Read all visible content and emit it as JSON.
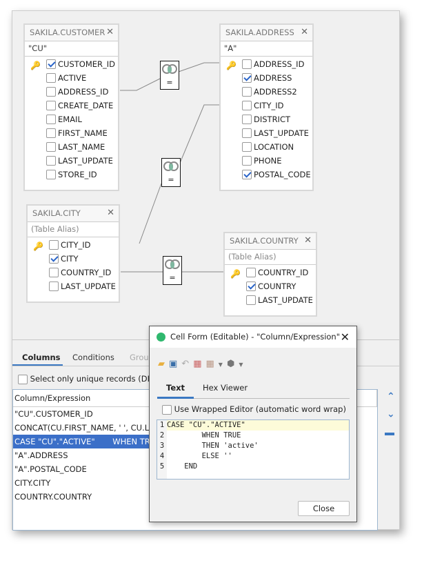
{
  "tables": [
    {
      "name": "SAKILA.CUSTOMER",
      "alias": "\"CU\"",
      "alias_placeholder": false,
      "columns": [
        {
          "label": "CUSTOMER_ID",
          "checked": true,
          "key": true
        },
        {
          "label": "ACTIVE",
          "checked": false
        },
        {
          "label": "ADDRESS_ID",
          "checked": false
        },
        {
          "label": "CREATE_DATE",
          "checked": false
        },
        {
          "label": "EMAIL",
          "checked": false
        },
        {
          "label": "FIRST_NAME",
          "checked": false
        },
        {
          "label": "LAST_NAME",
          "checked": false
        },
        {
          "label": "LAST_UPDATE",
          "checked": false
        },
        {
          "label": "STORE_ID",
          "checked": false
        }
      ]
    },
    {
      "name": "SAKILA.ADDRESS",
      "alias": "\"A\"",
      "alias_placeholder": false,
      "columns": [
        {
          "label": "ADDRESS_ID",
          "checked": false,
          "key": true
        },
        {
          "label": "ADDRESS",
          "checked": true
        },
        {
          "label": "ADDRESS2",
          "checked": false
        },
        {
          "label": "CITY_ID",
          "checked": false
        },
        {
          "label": "DISTRICT",
          "checked": false
        },
        {
          "label": "LAST_UPDATE",
          "checked": false
        },
        {
          "label": "LOCATION",
          "checked": false
        },
        {
          "label": "PHONE",
          "checked": false
        },
        {
          "label": "POSTAL_CODE",
          "checked": true
        }
      ]
    },
    {
      "name": "SAKILA.CITY",
      "alias": "(Table Alias)",
      "alias_placeholder": true,
      "columns": [
        {
          "label": "CITY_ID",
          "checked": false,
          "key": true
        },
        {
          "label": "CITY",
          "checked": true
        },
        {
          "label": "COUNTRY_ID",
          "checked": false
        },
        {
          "label": "LAST_UPDATE",
          "checked": false
        }
      ]
    },
    {
      "name": "SAKILA.COUNTRY",
      "alias": "(Table Alias)",
      "alias_placeholder": true,
      "columns": [
        {
          "label": "COUNTRY_ID",
          "checked": false,
          "key": true
        },
        {
          "label": "COUNTRY",
          "checked": true
        },
        {
          "label": "LAST_UPDATE",
          "checked": false
        }
      ]
    }
  ],
  "join_operator": "=",
  "bottom": {
    "tabs": [
      "Columns",
      "Conditions",
      "Group"
    ],
    "distinct_label": "Select only unique records (DISTI",
    "grid_header": "Column/Expression",
    "rows": [
      "\"CU\".CUSTOMER_ID",
      "CONCAT(CU.FIRST_NAME, ' ', CU.L...",
      "CASE \"CU\".\"ACTIVE\"       WHEN TR...",
      "\"A\".ADDRESS",
      "\"A\".POSTAL_CODE",
      "CITY.CITY",
      "COUNTRY.COUNTRY"
    ],
    "selected_row": 2
  },
  "dialog": {
    "title": "Cell Form (Editable) - \"Column/Expression\"",
    "tabs": [
      "Text",
      "Hex Viewer"
    ],
    "wrap_label": "Use Wrapped Editor (automatic word wrap)",
    "code": [
      "CASE \"CU\".\"ACTIVE\"",
      "        WHEN TRUE",
      "        THEN 'active'",
      "        ELSE ''",
      "    END"
    ],
    "close_label": "Close"
  },
  "colors": {
    "accent": "#3a78c2",
    "selection": "#3b6fc8"
  }
}
